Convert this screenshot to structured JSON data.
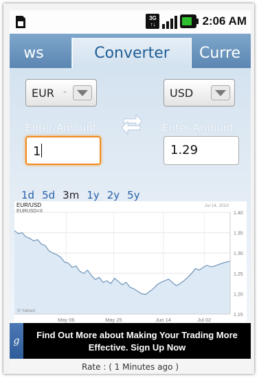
{
  "status_bar": {
    "time": "2:06 AM",
    "network": "3G",
    "icons": [
      "sim-icon",
      "3g-icon",
      "signal-icon",
      "battery-icon"
    ]
  },
  "tabs": [
    {
      "label": "ws",
      "active": false
    },
    {
      "label": "Converter",
      "active": true
    },
    {
      "label": "Curre",
      "active": false
    }
  ],
  "converter": {
    "from_currency": "EUR",
    "to_currency": "USD",
    "select_separator": "-",
    "from_label": "Enter Amount",
    "to_label": "Enter Amount",
    "from_amount": "1",
    "to_amount": "1.29"
  },
  "ranges": [
    {
      "label": "1d",
      "active": false
    },
    {
      "label": "5d",
      "active": false
    },
    {
      "label": "3m",
      "active": true
    },
    {
      "label": "1y",
      "active": false
    },
    {
      "label": "2y",
      "active": false
    },
    {
      "label": "5y",
      "active": false
    }
  ],
  "chart_data": {
    "type": "line",
    "title": "EUR/USD",
    "subtitle": "EURUSD=X",
    "date_stamp": "Jul 14, 2010",
    "watermark": "© Yahoo!",
    "xlabel": "",
    "ylabel": "",
    "x_ticks": [
      "May 06",
      "May 25",
      "Jun 14",
      "Jul 02"
    ],
    "y_ticks": [
      "1.15",
      "1.20",
      "1.25",
      "1.30",
      "1.35",
      "1.40"
    ],
    "ylim": [
      1.15,
      1.4
    ],
    "series": [
      {
        "values": [
          1.355,
          1.348,
          1.35,
          1.34,
          1.336,
          1.33,
          1.333,
          1.322,
          1.318,
          1.305,
          1.3,
          1.296,
          1.29,
          1.278,
          1.275,
          1.265,
          1.268,
          1.255,
          1.25,
          1.258,
          1.245,
          1.235,
          1.24,
          1.228,
          1.232,
          1.225,
          1.238,
          1.23,
          1.222,
          1.228,
          1.216,
          1.212,
          1.206,
          1.2,
          1.198,
          1.205,
          1.212,
          1.222,
          1.228,
          1.232,
          1.236,
          1.228,
          1.22,
          1.225,
          1.232,
          1.24,
          1.25,
          1.262,
          1.258,
          1.265,
          1.27,
          1.266,
          1.268,
          1.272,
          1.275,
          1.278,
          1.28
        ]
      }
    ]
  },
  "ad": {
    "badge": "g",
    "text": "Find Out More about Making Your Trading More Effective. Sign Up Now"
  },
  "footer": {
    "rate_text": "Rate :  ( 1 Minutes ago )"
  },
  "colors": {
    "accent": "#2860a8",
    "tab_bar": "#6a95c0",
    "focus_border": "#f08a1c",
    "chart_line": "#8aaed0",
    "chart_fill": "#dde9f5"
  }
}
